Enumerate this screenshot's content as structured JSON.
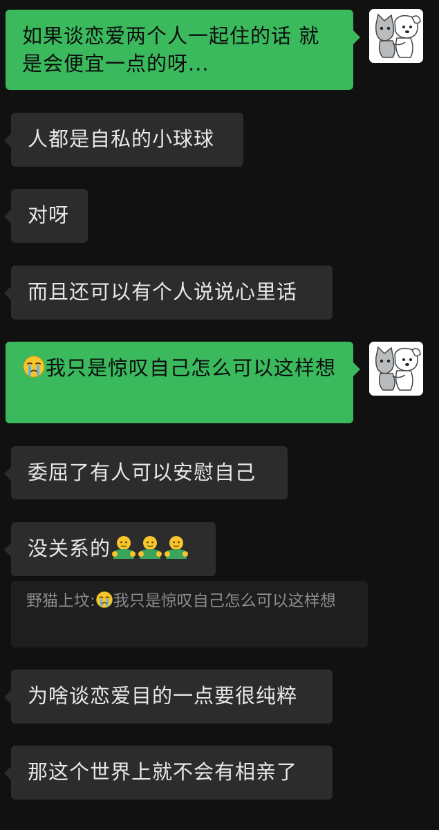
{
  "messages": [
    {
      "sender": "self",
      "text": "如果谈恋爱两个人一起住的话 就是会便宜一点的呀..."
    },
    {
      "sender": "other",
      "text": "人都是自私的小球球"
    },
    {
      "sender": "other",
      "text": "对呀"
    },
    {
      "sender": "other",
      "text": "而且还可以有个人说说心里话"
    },
    {
      "sender": "self",
      "emoji": "crying-face-emoji",
      "text": "我只是惊叹自己怎么可以这样想"
    },
    {
      "sender": "other",
      "text": "委屈了有人可以安慰自己"
    },
    {
      "sender": "other",
      "text": "没关系的",
      "emojis": [
        "hug-emoji",
        "hug-emoji",
        "hug-emoji"
      ]
    },
    {
      "sender": "other",
      "text": "为啥谈恋爱目的一点要很纯粹"
    },
    {
      "sender": "other",
      "text": "那这个世界上就不会有相亲了"
    }
  ],
  "quote": {
    "author": "野猫上坟:",
    "emoji": "crying-face-emoji",
    "text": "我只是惊叹自己怎么可以这样想"
  },
  "avatar": {
    "icon": "cartoon-cat-dog-avatar"
  },
  "colors": {
    "background": "#111111",
    "incoming_bubble": "#2c2c2c",
    "outgoing_bubble": "#3ab95d",
    "quote_background": "#1e1e1e"
  }
}
